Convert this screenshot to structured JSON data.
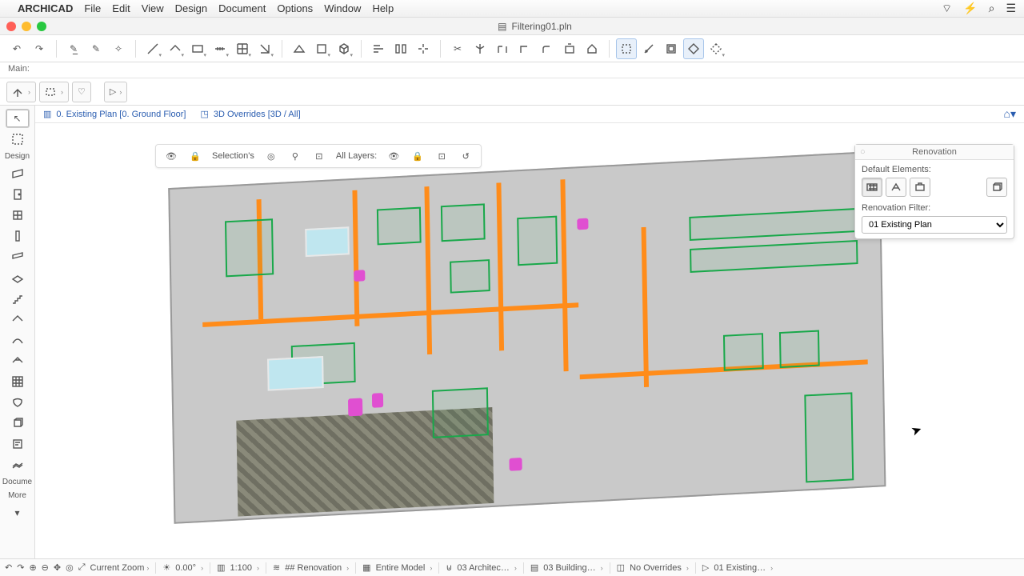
{
  "menu": {
    "app": "ARCHICAD",
    "items": [
      "File",
      "Edit",
      "View",
      "Design",
      "Document",
      "Options",
      "Window",
      "Help"
    ]
  },
  "window": {
    "doc_title": "Filtering01.pln"
  },
  "infobar": {
    "label": "Main:"
  },
  "tabs": {
    "plan": "0. Existing Plan [0. Ground Floor]",
    "three_d": "3D Overrides [3D / All]"
  },
  "filterbar": {
    "selection": "Selection's",
    "layers": "All Layers:"
  },
  "toolbox": {
    "section1": "Design",
    "section2": "Docume",
    "section3": "More"
  },
  "panel": {
    "title": "Renovation",
    "default_label": "Default Elements:",
    "filter_label": "Renovation Filter:",
    "filter_value": "01 Existing Plan"
  },
  "status": {
    "zoom_label": "Current Zoom",
    "angle": "0.00°",
    "scale": "1:100",
    "crumbs": [
      "## Renovation",
      "Entire Model",
      "03 Architec…",
      "03 Building…",
      "No Overrides",
      "01 Existing…"
    ]
  }
}
